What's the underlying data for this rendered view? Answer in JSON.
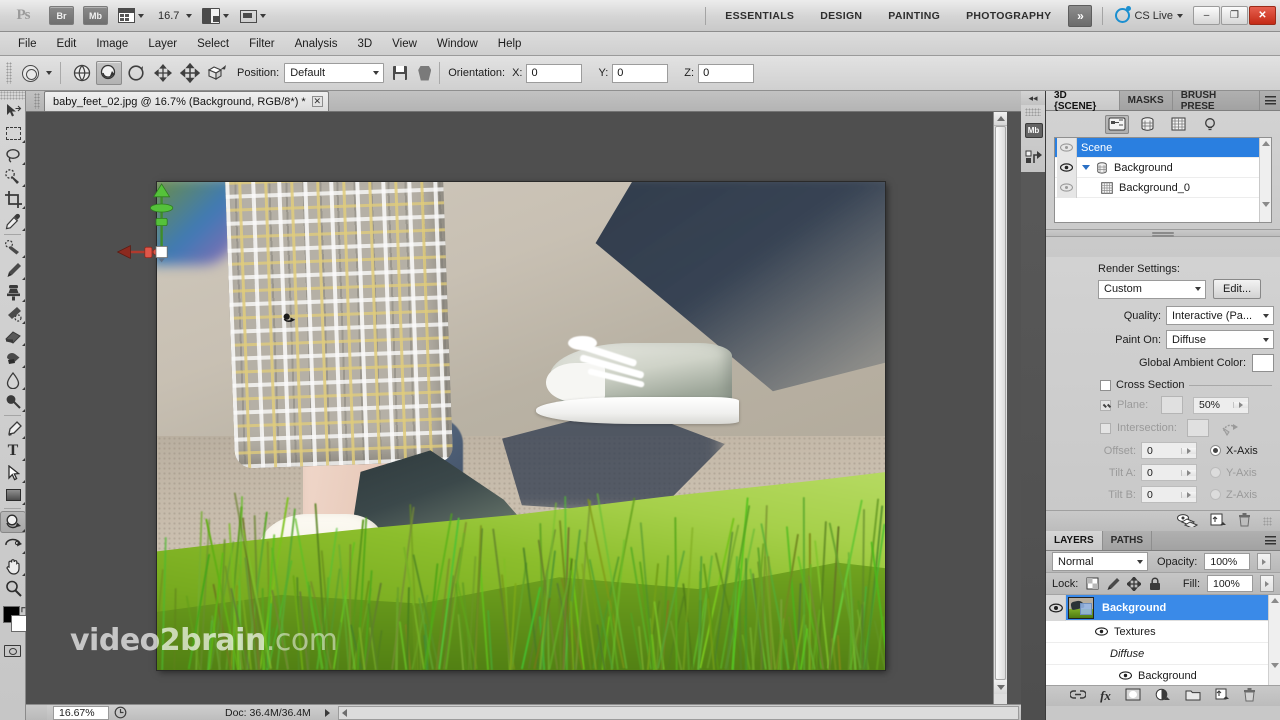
{
  "app": {
    "name": "Adobe Photoshop CS5",
    "logo_text": "Ps",
    "bridge_label": "Br",
    "minibridge_label": "Mb",
    "zoom_level": "16.7",
    "cs_live_label": "CS Live"
  },
  "workspaces": {
    "items": [
      {
        "label": "ESSENTIALS",
        "active": false
      },
      {
        "label": "DESIGN",
        "active": false
      },
      {
        "label": "PAINTING",
        "active": false
      },
      {
        "label": "PHOTOGRAPHY",
        "active": false
      }
    ],
    "more_label": "»"
  },
  "window_buttons": {
    "minimize": "–",
    "restore": "❐",
    "close": "✕"
  },
  "menubar": {
    "items": [
      "File",
      "Edit",
      "Image",
      "Layer",
      "Select",
      "Filter",
      "Analysis",
      "3D",
      "View",
      "Window",
      "Help"
    ]
  },
  "options_bar": {
    "position_label": "Position:",
    "position_value": "Default",
    "orientation_label": "Orientation:",
    "x_label": "X:",
    "x_value": "0",
    "y_label": "Y:",
    "y_value": "0",
    "z_label": "Z:",
    "z_value": "0",
    "tools": [
      {
        "name": "3d-object-rotate",
        "selected": false
      },
      {
        "name": "3d-object-roll",
        "selected": true
      },
      {
        "name": "3d-object-pan",
        "selected": false
      },
      {
        "name": "3d-object-slide",
        "selected": false
      },
      {
        "name": "3d-object-scale",
        "selected": false
      }
    ]
  },
  "toolbar": {
    "tools": [
      {
        "name": "move-tool",
        "selected": false,
        "has_submenu": false
      },
      {
        "name": "rectangular-marquee-tool",
        "selected": false,
        "has_submenu": true
      },
      {
        "name": "lasso-tool",
        "selected": false,
        "has_submenu": true
      },
      {
        "name": "quick-selection-tool",
        "selected": false,
        "has_submenu": true
      },
      {
        "name": "crop-tool",
        "selected": false,
        "has_submenu": true
      },
      {
        "name": "eyedropper-tool",
        "selected": false,
        "has_submenu": true
      },
      {
        "name": "spot-healing-brush-tool",
        "selected": false,
        "has_submenu": true
      },
      {
        "name": "brush-tool",
        "selected": false,
        "has_submenu": true
      },
      {
        "name": "clone-stamp-tool",
        "selected": false,
        "has_submenu": true
      },
      {
        "name": "history-brush-tool",
        "selected": false,
        "has_submenu": true
      },
      {
        "name": "eraser-tool",
        "selected": false,
        "has_submenu": true
      },
      {
        "name": "gradient-tool",
        "selected": false,
        "has_submenu": true
      },
      {
        "name": "blur-tool",
        "selected": false,
        "has_submenu": true
      },
      {
        "name": "dodge-tool",
        "selected": false,
        "has_submenu": true
      },
      {
        "name": "pen-tool",
        "selected": false,
        "has_submenu": true
      },
      {
        "name": "horizontal-type-tool",
        "selected": false,
        "has_submenu": true
      },
      {
        "name": "path-selection-tool",
        "selected": false,
        "has_submenu": true
      },
      {
        "name": "rectangle-tool",
        "selected": false,
        "has_submenu": true
      },
      {
        "name": "3d-object-rotate-tool",
        "selected": true,
        "has_submenu": true
      },
      {
        "name": "3d-camera-rotate-tool",
        "selected": false,
        "has_submenu": true
      },
      {
        "name": "hand-tool",
        "selected": false,
        "has_submenu": true
      },
      {
        "name": "zoom-tool",
        "selected": false,
        "has_submenu": false
      }
    ],
    "foreground_color": "#000000",
    "background_color": "#ffffff"
  },
  "document": {
    "tab_title": "baby_feet_02.jpg @ 16.7% (Background, RGB/8*) *",
    "close_label": "✕",
    "watermark_bold": "video2brain",
    "watermark_light": ".com"
  },
  "status_bar": {
    "zoom": "16.67%",
    "doc_info": "Doc: 36.4M/36.4M"
  },
  "panel_3d": {
    "tabs": [
      {
        "label": "3D {SCENE}",
        "active": true
      },
      {
        "label": "MASKS",
        "active": false
      },
      {
        "label": "BRUSH PRESE",
        "active": false
      }
    ],
    "filters": [
      {
        "name": "scene-filter-icon",
        "selected": true
      },
      {
        "name": "mesh-filter-icon",
        "selected": false
      },
      {
        "name": "materials-filter-icon",
        "selected": false
      },
      {
        "name": "lights-filter-icon",
        "selected": false
      }
    ],
    "tree": [
      {
        "label": "Scene",
        "indent": 0,
        "selected": true,
        "icon": "none",
        "visible": true
      },
      {
        "label": "Background",
        "indent": 1,
        "selected": false,
        "icon": "mesh-icon",
        "visible": true
      },
      {
        "label": "Background_0",
        "indent": 2,
        "selected": false,
        "icon": "material-icon",
        "visible": true
      }
    ],
    "mini_tools": [
      {
        "name": "3d-rotate-mesh-tool",
        "selected": true
      },
      {
        "name": "3d-roll-mesh-tool",
        "selected": false
      },
      {
        "name": "3d-pan-mesh-tool",
        "selected": false
      },
      {
        "name": "3d-slide-mesh-tool",
        "selected": false
      },
      {
        "name": "3d-scale-mesh-tool",
        "selected": false
      }
    ],
    "render_settings_label": "Render Settings:",
    "render_preset": "Custom",
    "edit_button": "Edit...",
    "quality_label": "Quality:",
    "quality_value": "Interactive (Pa...",
    "paint_on_label": "Paint On:",
    "paint_on_value": "Diffuse",
    "global_ambient_label": "Global Ambient Color:",
    "global_ambient_color": "#ffffff",
    "cross_section_label": "Cross Section",
    "cross_section_on": false,
    "plane_label": "Plane:",
    "plane_on": true,
    "plane_opacity": "50%",
    "intersection_label": "Intersection:",
    "intersection_on": false,
    "offset_label": "Offset:",
    "offset_value": "0",
    "tilt_a_label": "Tilt A:",
    "tilt_a_value": "0",
    "tilt_b_label": "Tilt B:",
    "tilt_b_value": "0",
    "axes": [
      {
        "label": "X-Axis",
        "selected": true
      },
      {
        "label": "Y-Axis",
        "selected": false
      },
      {
        "label": "Z-Axis",
        "selected": false
      }
    ],
    "footer_icons": [
      "toggle-ground-plane-icon",
      "new-light-icon",
      "delete-icon"
    ]
  },
  "panel_layers": {
    "tabs": [
      {
        "label": "LAYERS",
        "active": true
      },
      {
        "label": "PATHS",
        "active": false
      }
    ],
    "blend_mode": "Normal",
    "opacity_label": "Opacity:",
    "opacity_value": "100%",
    "lock_label": "Lock:",
    "lock_icons": [
      "lock-transparent-pixels-icon",
      "lock-image-pixels-icon",
      "lock-position-icon",
      "lock-all-icon"
    ],
    "fill_label": "Fill:",
    "fill_value": "100%",
    "rows": [
      {
        "label": "Background",
        "type": "layer",
        "selected": true,
        "visible": true,
        "indent": 0
      },
      {
        "label": "Textures",
        "type": "group",
        "selected": false,
        "visible": true,
        "indent": 1
      },
      {
        "label": "Diffuse",
        "type": "italic-header",
        "selected": false,
        "visible": false,
        "indent": 2
      },
      {
        "label": "Background",
        "type": "texture",
        "selected": false,
        "visible": true,
        "indent": 3
      }
    ],
    "footer_icons": [
      "link-layers-icon",
      "layer-style-icon",
      "layer-mask-icon",
      "adjustment-layer-icon",
      "new-group-icon",
      "new-layer-icon",
      "delete-layer-icon"
    ]
  },
  "colors": {
    "selection_blue": "#2a7fe0",
    "layer_selection_blue": "#3a8ae8",
    "close_red": "#c42a16",
    "axis_green": "#4caf2e",
    "axis_red": "#c0392b"
  }
}
